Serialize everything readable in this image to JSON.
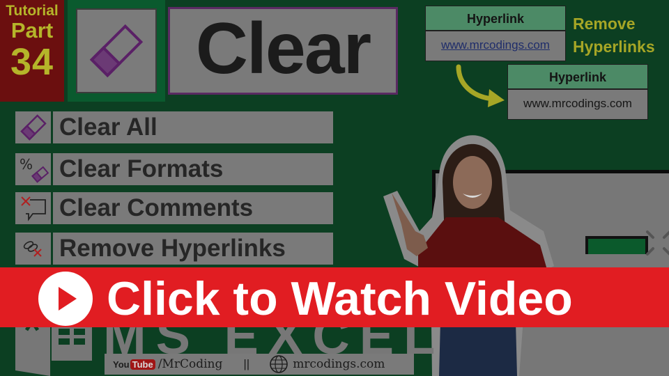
{
  "badge": {
    "line1": "Tutorial",
    "line2": "Part",
    "number": "34"
  },
  "title": "Clear",
  "hyperlink_example": {
    "before": {
      "header": "Hyperlink",
      "value": "www.mrcodings.com"
    },
    "after": {
      "header": "Hyperlink",
      "value": "www.mrcodings.com"
    },
    "label_line1": "Remove",
    "label_line2": "Hyperlinks"
  },
  "menu": [
    {
      "label": "Clear All",
      "icon": "eraser-icon"
    },
    {
      "label": "Clear Formats",
      "icon": "clear-formats-icon"
    },
    {
      "label": "Clear Comments",
      "icon": "clear-comments-icon"
    },
    {
      "label": "Remove Hyperlinks",
      "icon": "remove-hyperlink-icon"
    }
  ],
  "cta": {
    "label": "Click to Watch Video",
    "icon": "play-icon"
  },
  "brand": {
    "product": "MS EXCEL",
    "youtube_you": "You",
    "youtube_tube": "Tube",
    "channel": "/MrCoding",
    "separator": "||",
    "website": "mrcodings.com"
  },
  "colors": {
    "cta_red": "#e11d22",
    "background_green": "#0c3f22",
    "badge_red": "#6b0f0f",
    "accent_yellow": "#b5b52a",
    "eraser_purple": "#6b2a7a"
  }
}
